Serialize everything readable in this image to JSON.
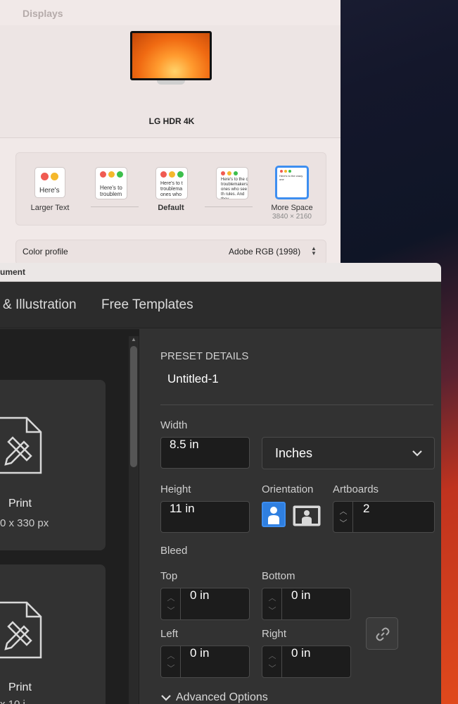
{
  "displays": {
    "title": "Displays",
    "monitor_name": "LG HDR 4K",
    "resolutions": [
      {
        "label": "Larger Text",
        "preview": "Here's",
        "bold": false,
        "sub": ""
      },
      {
        "label": "",
        "preview": "Here's to troublem",
        "bold": false,
        "sub": ""
      },
      {
        "label": "Default",
        "preview": "Here's to t troublema ones who",
        "bold": true,
        "sub": ""
      },
      {
        "label": "",
        "preview": "Here's to the c troublemakers. ones who see th rules. And they",
        "bold": false,
        "sub": ""
      },
      {
        "label": "More Space",
        "preview": "Here's to the crazy one",
        "bold": false,
        "sub": "3840 × 2160"
      }
    ],
    "color_profile_label": "Color profile",
    "color_profile_value": "Adobe RGB (1998)"
  },
  "document": {
    "window_title": "ument",
    "tabs": [
      "& Illustration",
      "Free Templates"
    ],
    "presets": [
      {
        "label": "Print",
        "sub": "0 x 330 px"
      },
      {
        "label": "Print",
        "sub": "x 10 i"
      }
    ],
    "preset_details": {
      "heading": "PRESET DETAILS",
      "name": "Untitled-1",
      "width_label": "Width",
      "width_value": "8.5 in",
      "units_value": "Inches",
      "height_label": "Height",
      "height_value": "11 in",
      "orientation_label": "Orientation",
      "artboards_label": "Artboards",
      "artboards_value": "2",
      "bleed_label": "Bleed",
      "top_label": "Top",
      "top_value": "0 in",
      "bottom_label": "Bottom",
      "bottom_value": "0 in",
      "left_label": "Left",
      "left_value": "0 in",
      "right_label": "Right",
      "right_value": "0 in",
      "advanced_label": "Advanced Options"
    }
  },
  "colors": {
    "accent_blue": "#3d8ef0",
    "dark_panel": "#323232"
  }
}
